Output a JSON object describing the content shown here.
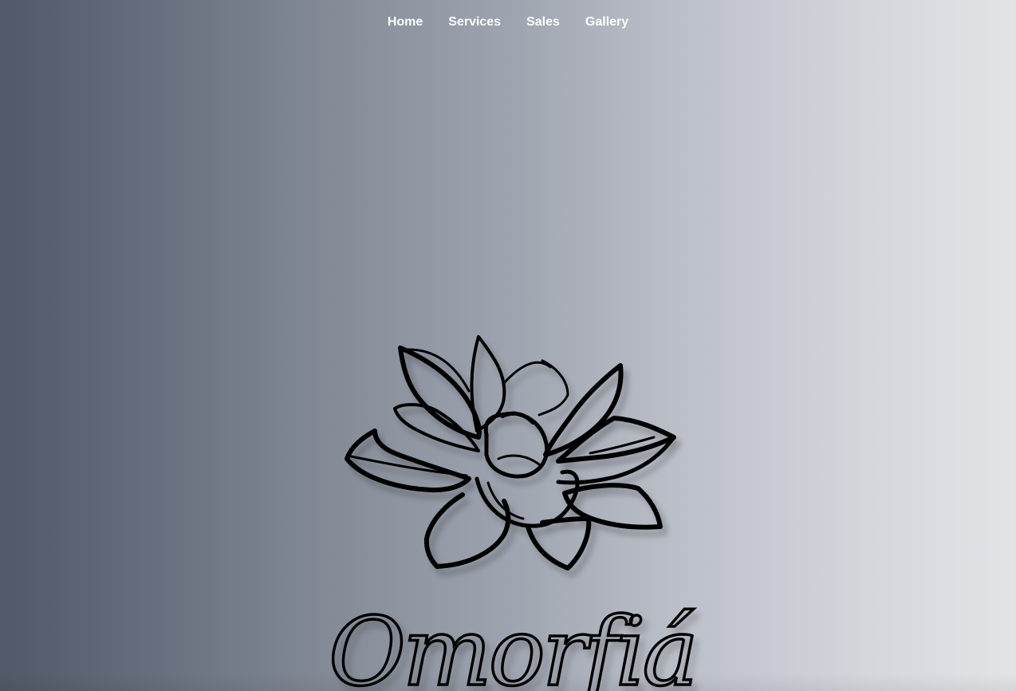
{
  "nav": {
    "items": [
      {
        "label": "Home"
      },
      {
        "label": "Services"
      },
      {
        "label": "Sales"
      },
      {
        "label": "Gallery"
      }
    ]
  },
  "hero": {
    "logo_icon": "lotus-flower-icon",
    "brand_name": "Omorfiá"
  },
  "colors": {
    "gradient_left": "#4f5967",
    "gradient_right": "#e3e4e8",
    "nav_text": "#ffffff",
    "logo_stroke": "#000000"
  }
}
